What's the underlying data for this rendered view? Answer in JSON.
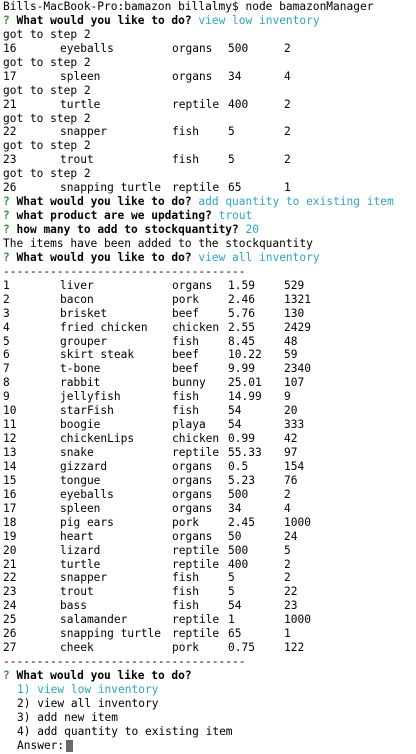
{
  "prompt_line": "Bills-MacBook-Pro:bamazon billalmy$ node bamazonManager",
  "q_mark": "?",
  "session1": {
    "question": "What would you like to do?",
    "answer": "view low inventory",
    "step_label": "got to step 2",
    "rows": [
      {
        "id": "16",
        "name": "eyeballs",
        "dept": "organs",
        "price": "500",
        "qty": "2"
      },
      {
        "id": "17",
        "name": "spleen",
        "dept": "organs",
        "price": "34",
        "qty": "4"
      },
      {
        "id": "21",
        "name": "turtle",
        "dept": "reptile",
        "price": "400",
        "qty": "2"
      },
      {
        "id": "22",
        "name": "snapper",
        "dept": "fish",
        "price": "5",
        "qty": "2"
      },
      {
        "id": "23",
        "name": "trout",
        "dept": "fish",
        "price": "5",
        "qty": "2"
      },
      {
        "id": "26",
        "name": "snapping turtle",
        "dept": "reptile",
        "price": "65",
        "qty": "1"
      }
    ]
  },
  "session2": {
    "question": "What would you like to do?",
    "answer": "add quantity to existing item",
    "product_question": "what product are we updating?",
    "product_answer": "trout",
    "qty_question": "how many to add to stockquantity?",
    "qty_answer": "20",
    "result": "The items have been added to the stockquantity"
  },
  "session3": {
    "question": "What would you like to do?",
    "answer": "view all inventory",
    "separator": "------------------------------------",
    "rows": [
      {
        "id": "1",
        "name": "liver",
        "dept": "organs",
        "price": "1.59",
        "qty": "529"
      },
      {
        "id": "2",
        "name": "bacon",
        "dept": "pork",
        "price": "2.46",
        "qty": "1321"
      },
      {
        "id": "3",
        "name": "brisket",
        "dept": "beef",
        "price": "5.76",
        "qty": "130"
      },
      {
        "id": "4",
        "name": "fried chicken",
        "dept": "chicken",
        "price": "2.55",
        "qty": "2429"
      },
      {
        "id": "5",
        "name": "grouper",
        "dept": "fish",
        "price": "8.45",
        "qty": "48"
      },
      {
        "id": "6",
        "name": "skirt steak",
        "dept": "beef",
        "price": "10.22",
        "qty": "59"
      },
      {
        "id": "7",
        "name": "t-bone",
        "dept": "beef",
        "price": "9.99",
        "qty": "2340"
      },
      {
        "id": "8",
        "name": "rabbit",
        "dept": "bunny",
        "price": "25.01",
        "qty": "107"
      },
      {
        "id": "9",
        "name": "jellyfish",
        "dept": "fish",
        "price": "14.99",
        "qty": "9"
      },
      {
        "id": "10",
        "name": "starFish",
        "dept": "fish",
        "price": "54",
        "qty": "20"
      },
      {
        "id": "11",
        "name": "boogie",
        "dept": "playa",
        "price": "54",
        "qty": "333"
      },
      {
        "id": "12",
        "name": "chickenLips",
        "dept": "chicken",
        "price": "0.99",
        "qty": "42"
      },
      {
        "id": "13",
        "name": "snake",
        "dept": "reptile",
        "price": "55.33",
        "qty": "97"
      },
      {
        "id": "14",
        "name": "gizzard",
        "dept": "organs",
        "price": "0.5",
        "qty": "154"
      },
      {
        "id": "15",
        "name": "tongue",
        "dept": "organs",
        "price": "5.23",
        "qty": "76"
      },
      {
        "id": "16",
        "name": "eyeballs",
        "dept": "organs",
        "price": "500",
        "qty": "2"
      },
      {
        "id": "17",
        "name": "spleen",
        "dept": "organs",
        "price": "34",
        "qty": "4"
      },
      {
        "id": "18",
        "name": "pig ears",
        "dept": "pork",
        "price": "2.45",
        "qty": "1000"
      },
      {
        "id": "19",
        "name": "heart",
        "dept": "organs",
        "price": "50",
        "qty": "24"
      },
      {
        "id": "20",
        "name": "lizard",
        "dept": "reptile",
        "price": "500",
        "qty": "5"
      },
      {
        "id": "21",
        "name": "turtle",
        "dept": "reptile",
        "price": "400",
        "qty": "2"
      },
      {
        "id": "22",
        "name": "snapper",
        "dept": "fish",
        "price": "5",
        "qty": "2"
      },
      {
        "id": "23",
        "name": "trout",
        "dept": "fish",
        "price": "5",
        "qty": "22"
      },
      {
        "id": "24",
        "name": "bass",
        "dept": "fish",
        "price": "54",
        "qty": "23"
      },
      {
        "id": "25",
        "name": "salamander",
        "dept": "reptile",
        "price": "1",
        "qty": "1000"
      },
      {
        "id": "26",
        "name": "snapping turtle",
        "dept": "reptile",
        "price": "65",
        "qty": "1"
      },
      {
        "id": "27",
        "name": "cheek",
        "dept": "pork",
        "price": "0.75",
        "qty": "122"
      }
    ]
  },
  "menu": {
    "question": "What would you like to do?",
    "options": [
      "1) view low inventory",
      "2) view all inventory",
      "3) add new item",
      "4) add quantity to existing item"
    ],
    "answer_label": "Answer:"
  },
  "colors": {
    "question_mark": "#3c8f3c",
    "answer_cyan": "#2ea5c4",
    "cursor": "#6b6b6b"
  }
}
